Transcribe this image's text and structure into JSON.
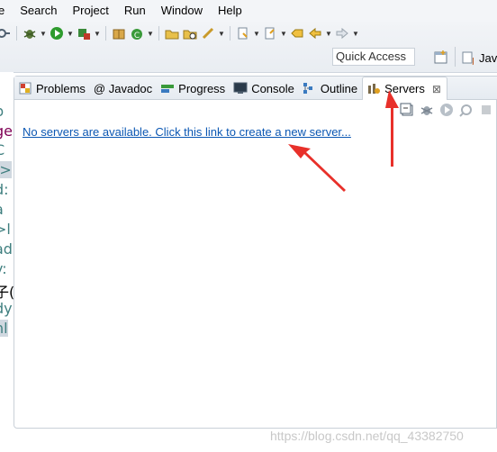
{
  "menu": {
    "items": [
      "e",
      "Search",
      "Project",
      "Run",
      "Window",
      "Help"
    ]
  },
  "toolbar": {
    "quick_access_placeholder": "Quick Access",
    "perspective_label": "Jav"
  },
  "editor": {
    "fragments": [
      {
        "text": "p",
        "color": "#3f7f7f"
      },
      {
        "text": "ge",
        "color": "#7f0055"
      },
      {
        "text": "C",
        "color": "#3f7f7f"
      },
      {
        "text": "|>",
        "color": "#3f7f7f"
      },
      {
        "text": "d:",
        "color": "#3f7f7f"
      },
      {
        "text": "a",
        "color": "#3f7f7f"
      },
      {
        "text": ">l",
        "color": "#3f7f7f"
      },
      {
        "text": "ad",
        "color": "#3f7f7f"
      },
      {
        "text": "y:",
        "color": "#3f7f7f"
      },
      {
        "text": "子(",
        "color": "#000000"
      },
      {
        "text": "dy",
        "color": "#3f7f7f"
      },
      {
        "text": "nl",
        "color": "#3f7f7f"
      }
    ]
  },
  "views": {
    "tabs": [
      {
        "label": "Problems",
        "icon": "problems-icon"
      },
      {
        "label": "@ Javadoc",
        "icon": "javadoc-icon"
      },
      {
        "label": "Progress",
        "icon": "progress-icon"
      },
      {
        "label": "Console",
        "icon": "console-icon"
      },
      {
        "label": "Outline",
        "icon": "outline-icon"
      },
      {
        "label": "Servers",
        "icon": "servers-icon",
        "active": true
      }
    ],
    "close_glyph": "⊠"
  },
  "servers": {
    "empty_link": "No servers are available. Click this link to create a new server..."
  },
  "watermark": "https://blog.csdn.net/qq_43382750",
  "colors": {
    "link": "#0b57b3",
    "annotation_arrow": "#e8302a",
    "tab_border": "#c9d0d8"
  }
}
